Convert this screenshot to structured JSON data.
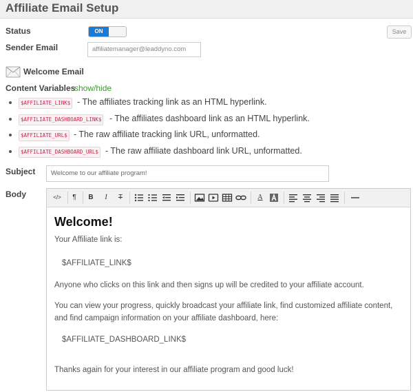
{
  "header": {
    "title": "Affiliate Email Setup"
  },
  "status": {
    "label": "Status",
    "toggle_label": "ON"
  },
  "save_label": "Save",
  "sender": {
    "label": "Sender Email",
    "value": "affiliatemanager@leaddyno.com"
  },
  "welcome": {
    "label": "Welcome Email",
    "icon": "envelope-icon"
  },
  "content_vars": {
    "label": "Content Variables",
    "toggle_link": "show/hide",
    "items": [
      {
        "code": "$AFFILIATE_LINK$",
        "desc": "- The affiliates tracking link as an HTML hyperlink."
      },
      {
        "code": "$AFFILIATE_DASHBOARD_LINK$",
        "desc": "- The affiliates dashboard link as an HTML hyperlink."
      },
      {
        "code": "$AFFILIATE_URL$",
        "desc": "- The raw affiliate tracking link URL, unformatted."
      },
      {
        "code": "$AFFILIATE_DASHBOARD_URL$",
        "desc": "- The raw affiliate dashboard link URL, unformatted."
      }
    ]
  },
  "subject": {
    "label": "Subject",
    "value": "Welcome to our affiliate program!"
  },
  "body": {
    "label": "Body",
    "toolbar": {
      "html": "</>",
      "paragraph": "¶",
      "bold": "B",
      "italic": "I",
      "strike": "T",
      "color": "A"
    },
    "content": {
      "heading": "Welcome!",
      "p1": "Your Affiliate link is:",
      "p2": "$AFFILIATE_LINK$",
      "p3": "Anyone who clicks on this link and then signs up will be credited to your affiliate account.",
      "p4a": "You can view your progress, quickly broadcast your affiliate link, find customized affiliate content,",
      "p4b": "and find campaign information on your affiliate dashboard, here:",
      "p5": "$AFFILIATE_DASHBOARD_LINK$",
      "p6": "Thanks again for your interest in our affiliate program and good luck!"
    }
  },
  "colors": {
    "accent": "#1a7ad4",
    "link": "#3a9a2e",
    "code": "#c7254e"
  }
}
